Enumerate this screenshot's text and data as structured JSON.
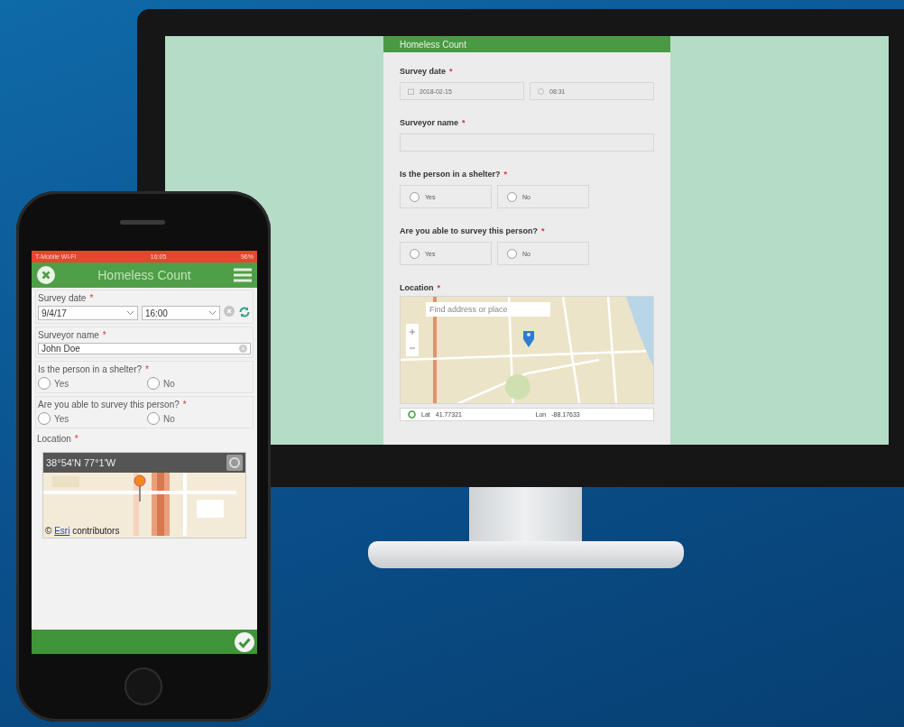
{
  "desktop": {
    "form_title": "Homeless Count",
    "fields": [
      {
        "kind": "datetime",
        "label": "Survey date",
        "required_mark": "*",
        "date": "2018-02-15",
        "time": "08:31"
      },
      {
        "kind": "text",
        "label": "Surveyor name",
        "required_mark": "*"
      },
      {
        "kind": "radio",
        "label": "Is the person in a shelter?",
        "required_mark": "*",
        "options": [
          {
            "label": "Yes",
            "selected": false
          },
          {
            "label": "No",
            "selected": false
          }
        ]
      },
      {
        "kind": "radio",
        "label": "Are you able to survey this person?",
        "required_mark": "*",
        "options": [
          {
            "label": "Yes",
            "selected": false
          },
          {
            "label": "No",
            "selected": false
          }
        ]
      },
      {
        "kind": "map",
        "label": "Location",
        "required_mark": "*",
        "search_placeholder": "Find address or place",
        "lat_label": "Lat",
        "lat": "41.77321",
        "lon_label": "Lon",
        "lon": "-88.17633"
      }
    ]
  },
  "phone": {
    "status_bar": {
      "carrier": "T-Mobile Wi-Fi",
      "time": "16:05",
      "battery": "96%"
    },
    "title": "Homeless Count",
    "fields": [
      {
        "kind": "datetime",
        "label": "Survey date",
        "required_mark": "*",
        "date": "9/4/17",
        "time": "16:00"
      },
      {
        "kind": "text",
        "label": "Surveyor name",
        "required_mark": "*",
        "value": "John Doe"
      },
      {
        "kind": "radio",
        "label": "Is the person in a shelter?",
        "required_mark": "*",
        "options": [
          {
            "label": "Yes",
            "selected": false
          },
          {
            "label": "No",
            "selected": false
          }
        ]
      },
      {
        "kind": "radio",
        "label": "Are you able to survey this person?",
        "required_mark": "*",
        "options": [
          {
            "label": "Yes",
            "selected": false
          },
          {
            "label": "No",
            "selected": false
          }
        ]
      },
      {
        "kind": "map",
        "label": "Location",
        "required_mark": "*",
        "coordinates": "38°54'N 77°1'W",
        "attribution_prefix": "©",
        "attribution_link": "Esri",
        "attribution_text": "contributors"
      }
    ]
  }
}
